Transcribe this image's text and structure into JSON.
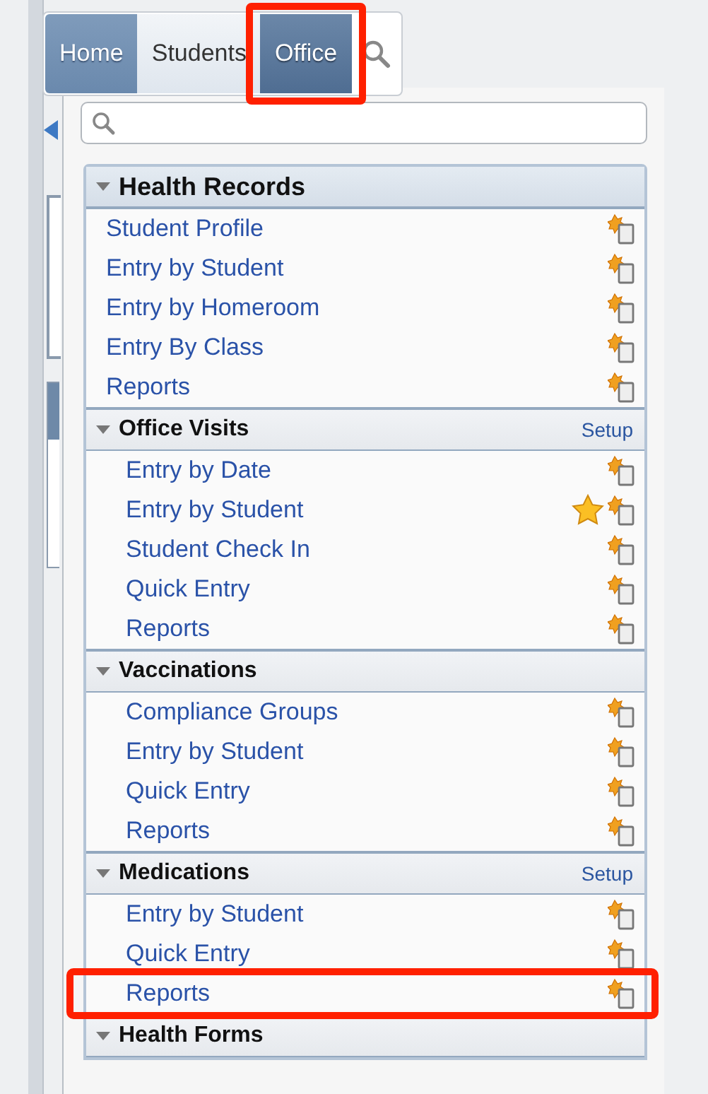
{
  "tabs": [
    {
      "label": "Home",
      "kind": "home",
      "selected": false,
      "highlighted": false
    },
    {
      "label": "Students",
      "kind": "plain",
      "selected": false,
      "highlighted": false
    },
    {
      "label": "Office",
      "kind": "plain",
      "selected": true,
      "highlighted": true
    }
  ],
  "sections": [
    {
      "title": "Health Records",
      "kind": "main",
      "expanded": true,
      "items": [
        {
          "label": "Student Profile",
          "favorite": false,
          "highlighted": false
        },
        {
          "label": "Entry by Student",
          "favorite": false,
          "highlighted": false
        },
        {
          "label": "Entry by Homeroom",
          "favorite": false,
          "highlighted": false
        },
        {
          "label": "Entry By Class",
          "favorite": false,
          "highlighted": false
        },
        {
          "label": "Reports",
          "favorite": false,
          "highlighted": false
        }
      ]
    },
    {
      "title": "Office Visits",
      "kind": "sub",
      "expanded": true,
      "link": "Setup",
      "items": [
        {
          "label": "Entry by Date",
          "favorite": false,
          "highlighted": false
        },
        {
          "label": "Entry by Student",
          "favorite": true,
          "highlighted": false
        },
        {
          "label": "Student Check In",
          "favorite": false,
          "highlighted": false
        },
        {
          "label": "Quick Entry",
          "favorite": false,
          "highlighted": false
        },
        {
          "label": "Reports",
          "favorite": false,
          "highlighted": false
        }
      ]
    },
    {
      "title": "Vaccinations",
      "kind": "sub",
      "expanded": true,
      "items": [
        {
          "label": "Compliance Groups",
          "favorite": false,
          "highlighted": false
        },
        {
          "label": "Entry by Student",
          "favorite": false,
          "highlighted": false
        },
        {
          "label": "Quick Entry",
          "favorite": false,
          "highlighted": false
        },
        {
          "label": "Reports",
          "favorite": false,
          "highlighted": false
        }
      ]
    },
    {
      "title": "Medications",
      "kind": "sub",
      "expanded": true,
      "link": "Setup",
      "items": [
        {
          "label": "Entry by Student",
          "favorite": false,
          "highlighted": false
        },
        {
          "label": "Quick Entry",
          "favorite": false,
          "highlighted": false
        },
        {
          "label": "Reports",
          "favorite": false,
          "highlighted": true
        }
      ]
    },
    {
      "title": "Health Forms",
      "kind": "sub",
      "expanded": true
    }
  ]
}
